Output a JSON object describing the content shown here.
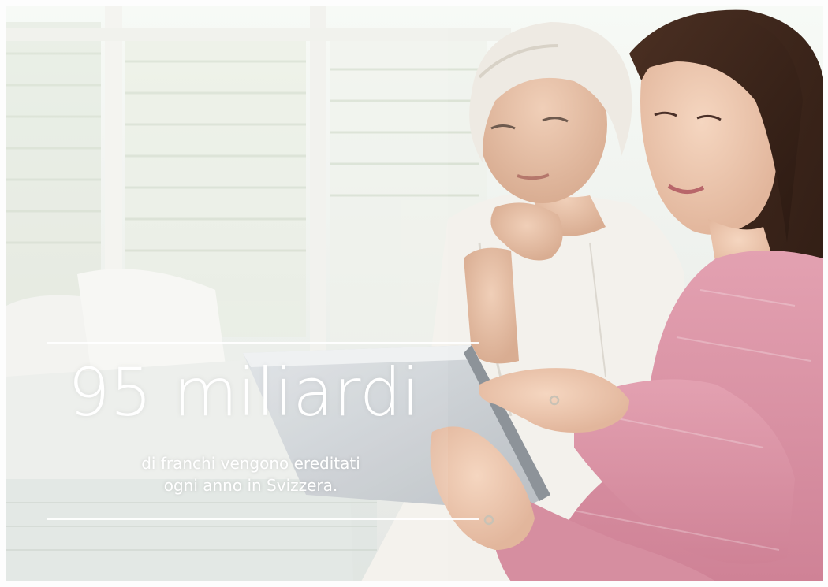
{
  "headline": "95 miliardi",
  "caption": {
    "line1": "di franchi vengono ereditati",
    "line2": "ogni anno in Svizzera."
  },
  "colors": {
    "text": "#ffffff",
    "rule": "#ffffff",
    "cardigan": "#d98fa1",
    "blouse": "#f3f1ec"
  }
}
